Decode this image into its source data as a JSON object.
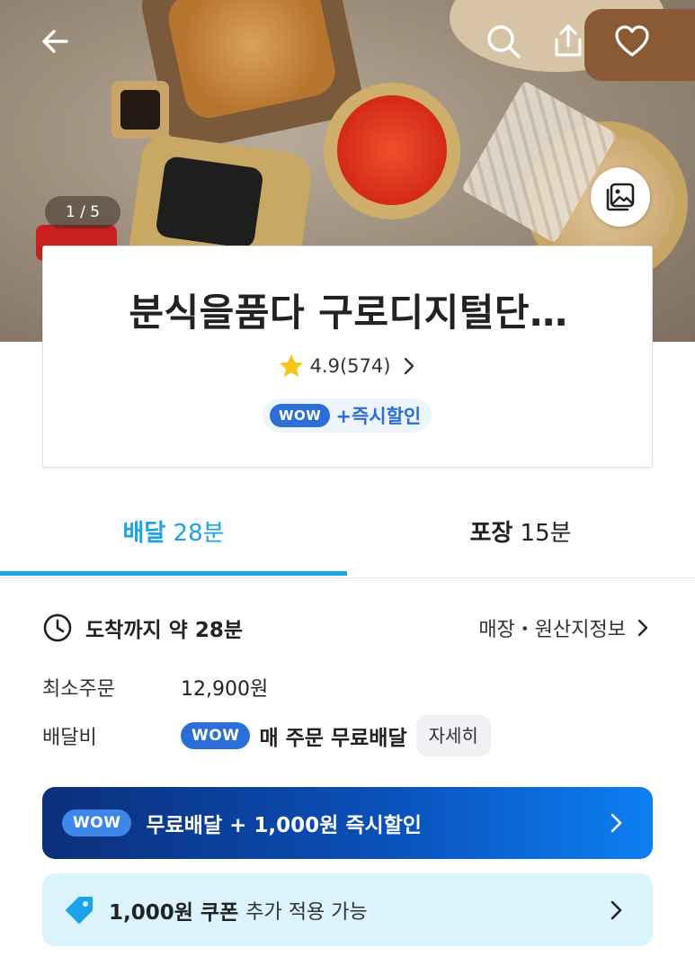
{
  "hero": {
    "counter": "1 / 5"
  },
  "card": {
    "store_name": "분식을품다 구로디지털단…",
    "rating": "4.9(574)",
    "wow_badge": "WOW",
    "promo": "+즉시할인"
  },
  "tabs": [
    {
      "label": "배달",
      "time": "28분",
      "active": true
    },
    {
      "label": "포장",
      "time": "15분",
      "active": false
    }
  ],
  "info": {
    "eta": "도착까지 약 28분",
    "store_info_link": "매장・원산지정보",
    "min_order_label": "최소주문",
    "min_order_value": "12,900원",
    "fee_label": "배달비",
    "fee_wow_badge": "WOW",
    "fee_text": "매 주문 무료배달",
    "detail_button": "자세히"
  },
  "banners": {
    "wow_badge": "WOW",
    "wow_text": "무료배달 + 1,000원 즉시할인",
    "coupon_strong": "1,000원 쿠폰",
    "coupon_rest": "추가 적용 가능"
  },
  "colors": {
    "accent": "#1aa3e8",
    "wow_blue": "#2b6ed8",
    "star": "#f5c518",
    "coupon_bg": "#dbf3fc"
  },
  "icons": [
    "back-arrow-icon",
    "search-icon",
    "share-icon",
    "heart-icon",
    "gallery-icon",
    "star-icon",
    "chevron-right-icon",
    "clock-icon",
    "coupon-tag-icon"
  ]
}
